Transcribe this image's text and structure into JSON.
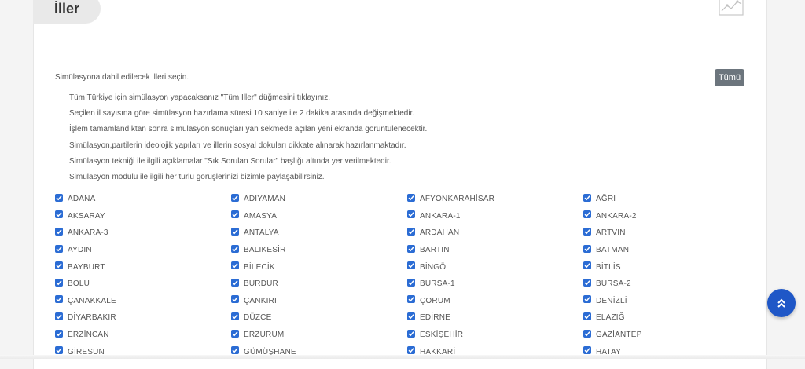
{
  "section": {
    "title": "İller"
  },
  "icons": {
    "chart": "chart-line-icon",
    "scroll_top": "double-chevron-up-icon",
    "checkbox": "check-icon"
  },
  "colors": {
    "checkbox": "#2b6cd4",
    "button": "#6c757d",
    "scroll_button": "#1f57c7"
  },
  "intro": "Simülasyona dahil edilecek illeri seçin.",
  "select_all_label": "Tümü",
  "notes": [
    "Tüm Türkiye için simülasyon yapacaksanız \"Tüm İller\" düğmesini tıklayınız.",
    "Seçilen il sayısına göre simülasyon hazırlama süresi 10 saniye ile 2 dakika arasında değişmektedir.",
    "İşlem tamamlandıktan sonra simülasyon sonuçları yan sekmede açılan yeni ekranda görüntülenecektir.",
    "Simülasyon,partilerin ideolojik yapıları ve illerin sosyal dokuları dikkate alınarak hazırlanmaktadır.",
    "Simülasyon tekniği ile ilgili açıklamalar \"Sık Sorulan Sorular\" başlığı altında yer verilmektedir.",
    "Simülasyon modülü ile ilgili her türlü görüşlerinizi bizimle paylaşabilirsiniz."
  ],
  "provinces": [
    {
      "name": "ADANA",
      "checked": true
    },
    {
      "name": "ADIYAMAN",
      "checked": true
    },
    {
      "name": "AFYONKARAHİSAR",
      "checked": true
    },
    {
      "name": "AĞRI",
      "checked": true
    },
    {
      "name": "AKSARAY",
      "checked": true
    },
    {
      "name": "AMASYA",
      "checked": true
    },
    {
      "name": "ANKARA-1",
      "checked": true
    },
    {
      "name": "ANKARA-2",
      "checked": true
    },
    {
      "name": "ANKARA-3",
      "checked": true
    },
    {
      "name": "ANTALYA",
      "checked": true
    },
    {
      "name": "ARDAHAN",
      "checked": true
    },
    {
      "name": "ARTVİN",
      "checked": true
    },
    {
      "name": "AYDIN",
      "checked": true
    },
    {
      "name": "BALIKESİR",
      "checked": true
    },
    {
      "name": "BARTIN",
      "checked": true
    },
    {
      "name": "BATMAN",
      "checked": true
    },
    {
      "name": "BAYBURT",
      "checked": true
    },
    {
      "name": "BİLECİK",
      "checked": true
    },
    {
      "name": "BİNGÖL",
      "checked": true
    },
    {
      "name": "BİTLİS",
      "checked": true
    },
    {
      "name": "BOLU",
      "checked": true
    },
    {
      "name": "BURDUR",
      "checked": true
    },
    {
      "name": "BURSA-1",
      "checked": true
    },
    {
      "name": "BURSA-2",
      "checked": true
    },
    {
      "name": "ÇANAKKALE",
      "checked": true
    },
    {
      "name": "ÇANKIRI",
      "checked": true
    },
    {
      "name": "ÇORUM",
      "checked": true
    },
    {
      "name": "DENİZLİ",
      "checked": true
    },
    {
      "name": "DİYARBAKIR",
      "checked": true
    },
    {
      "name": "DÜZCE",
      "checked": true
    },
    {
      "name": "EDİRNE",
      "checked": true
    },
    {
      "name": "ELAZIĞ",
      "checked": true
    },
    {
      "name": "ERZİNCAN",
      "checked": true
    },
    {
      "name": "ERZURUM",
      "checked": true
    },
    {
      "name": "ESKİŞEHİR",
      "checked": true
    },
    {
      "name": "GAZİANTEP",
      "checked": true
    },
    {
      "name": "GİRESUN",
      "checked": true
    },
    {
      "name": "GÜMÜŞHANE",
      "checked": true
    },
    {
      "name": "HAKKARİ",
      "checked": true
    },
    {
      "name": "HATAY",
      "checked": true
    }
  ]
}
